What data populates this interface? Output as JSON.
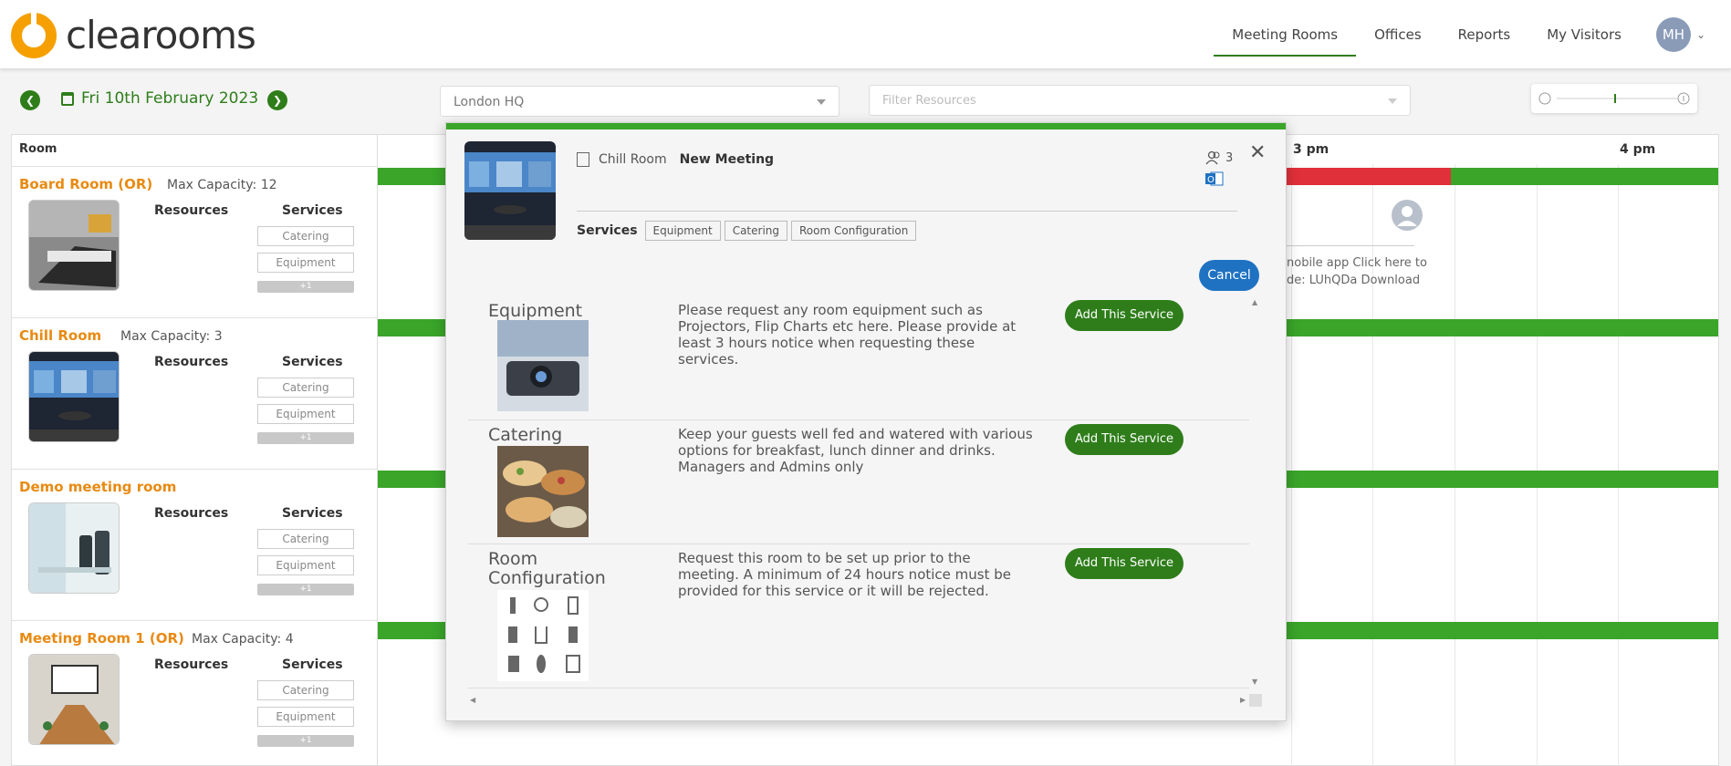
{
  "header": {
    "logo_text": "clearooms",
    "brand_color": "#f5a000",
    "nav": [
      {
        "label": "Meeting Rooms",
        "active": true
      },
      {
        "label": "Offices",
        "active": false
      },
      {
        "label": "Reports",
        "active": false
      },
      {
        "label": "My Visitors",
        "active": false
      }
    ],
    "avatar_initials": "MH"
  },
  "toolbar": {
    "date": "Fri 10th February 2023",
    "location": "London HQ",
    "filter_placeholder": "Filter Resources"
  },
  "grid": {
    "room_header": "Room",
    "hours": [
      "3 pm",
      "4 pm"
    ],
    "colors": {
      "available": "#3aa529",
      "busy": "#e0303a",
      "room_name": "#e88a12"
    },
    "rooms": [
      {
        "name": "Board Room (OR)",
        "capacity": "Max Capacity: 12",
        "resources_label": "Resources",
        "services_label": "Services",
        "chips": [
          "Catering",
          "Equipment"
        ],
        "more": "+1"
      },
      {
        "name": "Chill Room",
        "capacity": "Max Capacity: 3",
        "resources_label": "Resources",
        "services_label": "Services",
        "chips": [
          "Catering",
          "Equipment"
        ],
        "more": "+1"
      },
      {
        "name": "Demo meeting room",
        "capacity": "",
        "resources_label": "Resources",
        "services_label": "Services",
        "chips": [
          "Catering",
          "Equipment"
        ],
        "more": "+1"
      },
      {
        "name": "Meeting Room 1 (OR)",
        "capacity": "Max Capacity: 4",
        "resources_label": "Resources",
        "services_label": "Services",
        "chips": [
          "Catering",
          "Equipment"
        ],
        "more": "+1"
      }
    ],
    "visitor_text_1": "nobile app Click here to",
    "visitor_text_2": "de: LUhQDa Download"
  },
  "modal": {
    "room": "Chill Room",
    "title": "New Meeting",
    "attendees": "3",
    "outlook_letter": "O",
    "services_label": "Services",
    "tabs": [
      "Equipment",
      "Catering",
      "Room Configuration"
    ],
    "cancel_label": "Cancel",
    "services": [
      {
        "title": "Equipment",
        "description": "Please request any room equipment such as Projectors, Flip Charts etc here. Please provide at least 3 hours notice when requesting these services.",
        "button": "Add This Service"
      },
      {
        "title": "Catering",
        "description": "Keep your guests well fed and watered with various options for breakfast, lunch dinner and drinks. Managers and Admins only",
        "button": "Add This Service"
      },
      {
        "title": "Room Configuration",
        "description": "Request this room to be set up prior to the meeting. A minimum of 24 hours notice must be provided for this service or it will be rejected.",
        "button": "Add This Service"
      }
    ]
  }
}
